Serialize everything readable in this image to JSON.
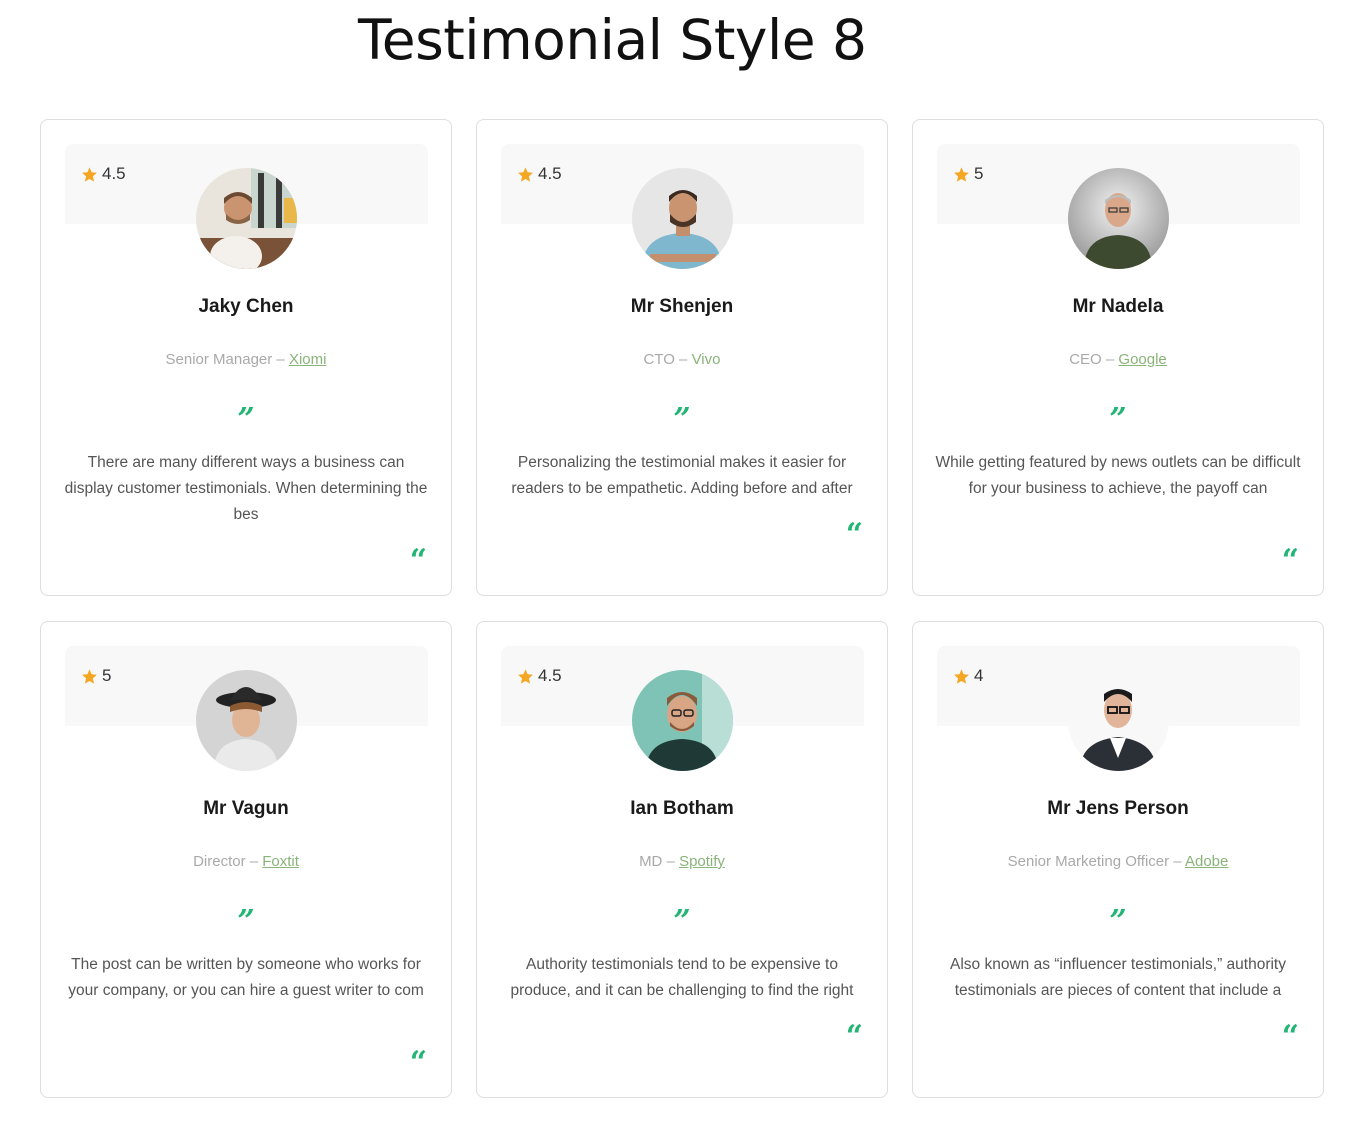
{
  "page": {
    "title": "Testimonial Style 8"
  },
  "colors": {
    "accent": "#22b573",
    "star": "#f5a623",
    "company": "#8ab37a"
  },
  "icons": {
    "rating": "star-icon",
    "quote_open": "quote-open-icon",
    "quote_close": "quote-close-icon"
  },
  "quote_marks": {
    "open": "”",
    "close": "“"
  },
  "testimonials": [
    {
      "rating": "4.5",
      "name": "Jaky Chen",
      "role": "Senior Manager – ",
      "company": "Xiomi",
      "company_linked": true,
      "text": "There are many different ways a business can display customer testimonials. When determining the bes"
    },
    {
      "rating": "4.5",
      "name": "Mr Shenjen",
      "role": "CTO – ",
      "company": "Vivo",
      "company_linked": false,
      "text": "Personalizing the testimonial makes it easier for readers to be empathetic. Adding before and after"
    },
    {
      "rating": "5",
      "name": "Mr Nadela",
      "role": "CEO – ",
      "company": "Google",
      "company_linked": true,
      "text": "While getting featured by news outlets can be difficult for your business to achieve, the payoff can"
    },
    {
      "rating": "5",
      "name": "Mr Vagun",
      "role": "Director – ",
      "company": "Foxtit",
      "company_linked": true,
      "text": "The post can be written by someone who works for your company, or you can hire a guest writer to com"
    },
    {
      "rating": "4.5",
      "name": "Ian Botham",
      "role": "MD – ",
      "company": "Spotify",
      "company_linked": true,
      "text": "Authority testimonials tend to be expensive to produce, and it can be challenging to find the right"
    },
    {
      "rating": "4",
      "name": "Mr Jens Person",
      "role": "Senior Marketing Officer – ",
      "company": "Adobe",
      "company_linked": true,
      "text": "Also known as “influencer testimonials,” authority testimonials are pieces of content that include a"
    }
  ]
}
